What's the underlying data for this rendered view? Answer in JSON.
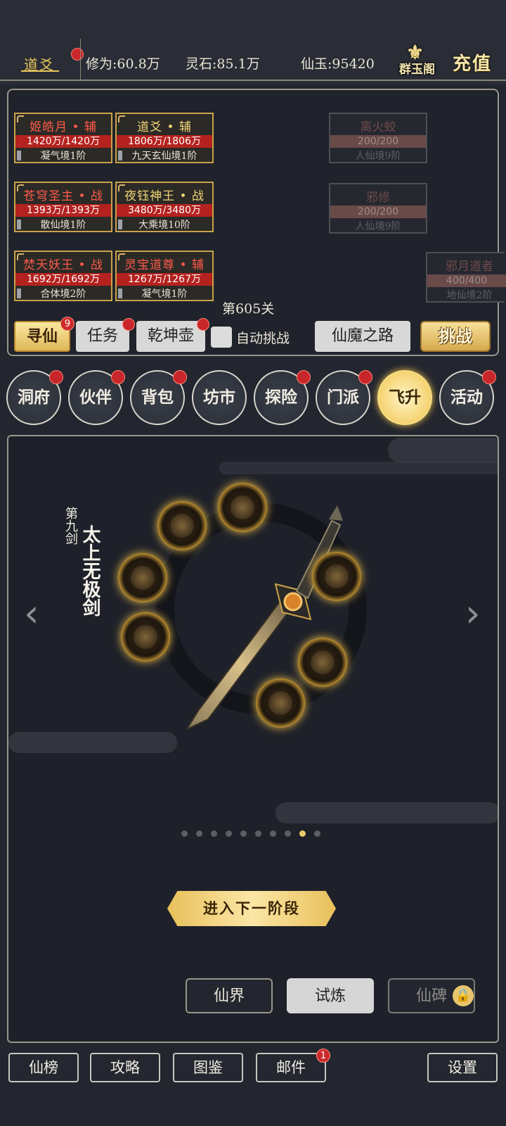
{
  "topbar": {
    "nickname": "道爻",
    "cultivation": "修为:60.8万",
    "spirit_stone": "灵石:85.1万",
    "immortal_jade": "仙玉:95420",
    "logo_text": "群玉阁",
    "recharge": "充值"
  },
  "allies": [
    {
      "name": "姬皓月 • 辅",
      "hp": "1420万/1420万",
      "realm": "凝气境1阶",
      "name_color": "red"
    },
    {
      "name": "道爻 • 辅",
      "hp": "1806万/1806万",
      "realm": "九天玄仙境1阶",
      "name_color": "gold"
    },
    {
      "name": "苍穹圣主 • 战",
      "hp": "1393万/1393万",
      "realm": "散仙境1阶",
      "name_color": "red"
    },
    {
      "name": "夜钰神王 • 战",
      "hp": "3480万/3480万",
      "realm": "大乘境10阶",
      "name_color": "gold"
    },
    {
      "name": "焚天妖王 • 战",
      "hp": "1692万/1692万",
      "realm": "合体境2阶",
      "name_color": "red"
    },
    {
      "name": "灵宝道尊 • 辅",
      "hp": "1267万/1267万",
      "realm": "凝气境1阶",
      "name_color": "red"
    }
  ],
  "enemies": [
    {
      "name": "离火蛟",
      "hp": "200/200",
      "realm": "人仙境9阶"
    },
    {
      "name": "邪修",
      "hp": "200/200",
      "realm": "人仙境9阶"
    },
    {
      "name": "邪月道者",
      "hp": "400/400",
      "realm": "地仙境2阶"
    }
  ],
  "stage": "第605关",
  "actions": {
    "seek": "寻仙",
    "seek_badge": "9",
    "task": "任务",
    "pot": "乾坤壶",
    "auto": "自动挑战",
    "road": "仙魔之路",
    "challenge": "挑战"
  },
  "menu": [
    {
      "label": "洞府",
      "dot": true
    },
    {
      "label": "伙伴",
      "dot": true
    },
    {
      "label": "背包",
      "dot": true
    },
    {
      "label": "坊市",
      "dot": false
    },
    {
      "label": "探险",
      "dot": true
    },
    {
      "label": "门派",
      "dot": true
    },
    {
      "label": "飞升",
      "dot": false,
      "active": true
    },
    {
      "label": "活动",
      "dot": true
    }
  ],
  "ascension": {
    "subtitle": "第九剑",
    "title": "太上无极剑",
    "page_count": 10,
    "active_page": 9,
    "next_button": "进入下一阶段"
  },
  "sub_tabs": {
    "realm": "仙界",
    "trial": "试炼",
    "stele": "仙碑"
  },
  "bottom": {
    "rank": "仙榜",
    "guide": "攻略",
    "atlas": "图鉴",
    "mail": "邮件",
    "mail_badge": "1",
    "settings": "设置"
  },
  "colors": {
    "background": "#23262f",
    "gold": "#e6c55c",
    "hp_red": "#b4221f",
    "dot_red": "#c8262a"
  }
}
